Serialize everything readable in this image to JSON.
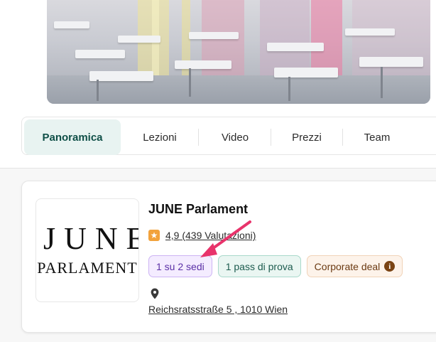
{
  "tabs": [
    {
      "label": "Panoramica",
      "active": true
    },
    {
      "label": "Lezioni",
      "active": false
    },
    {
      "label": "Video",
      "active": false
    },
    {
      "label": "Prezzi",
      "active": false
    },
    {
      "label": "Team",
      "active": false
    }
  ],
  "studio": {
    "logo_line1": "JUNE",
    "logo_line2": "PARLAMENT",
    "name": "JUNE Parlament",
    "rating_text": "4,9 (439 Valutazioni)",
    "badges": {
      "locations": "1 su 2 sedi",
      "trial": "1 pass di prova",
      "corporate": "Corporate deal"
    },
    "address": "Reichsratsstraße 5 , 1010 Wien"
  },
  "icons": {
    "rating": "star-icon",
    "info": "info-icon",
    "location": "map-pin-icon",
    "annotation": "arrow-annotation"
  },
  "colors": {
    "active_tab_bg": "#e8f3f1",
    "active_tab_text": "#0f4f47",
    "star": "#f2a23c",
    "annotation_arrow": "#e8336b"
  }
}
